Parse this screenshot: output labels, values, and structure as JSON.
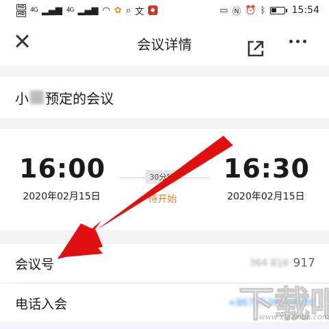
{
  "status_bar": {
    "hd1": "HD",
    "hd2": "HD",
    "signal1": "4G",
    "signal2": "4G",
    "battery_level": 0.42,
    "time": "15:54"
  },
  "nav": {
    "title": "会议详情"
  },
  "meeting": {
    "title_prefix": "小",
    "title_suffix": "预定的会议",
    "start_time": "16:00",
    "start_date": "2020年02月15日",
    "end_time": "16:30",
    "end_date": "2020年02月15日",
    "duration": "30分钟",
    "status": "待开始"
  },
  "details": {
    "meeting_id_label": "会议号",
    "meeting_id_value_hidden": "364 816",
    "meeting_id_value": "917",
    "dial_in_label": "电话入会",
    "dial_in_value": "+8675536550000"
  },
  "watermark": {
    "text": "www.xiazaiba.com"
  },
  "colors": {
    "accent_orange": "#e8832a",
    "arrow_red": "#e01010",
    "link_blue": "#3a8ee6"
  }
}
